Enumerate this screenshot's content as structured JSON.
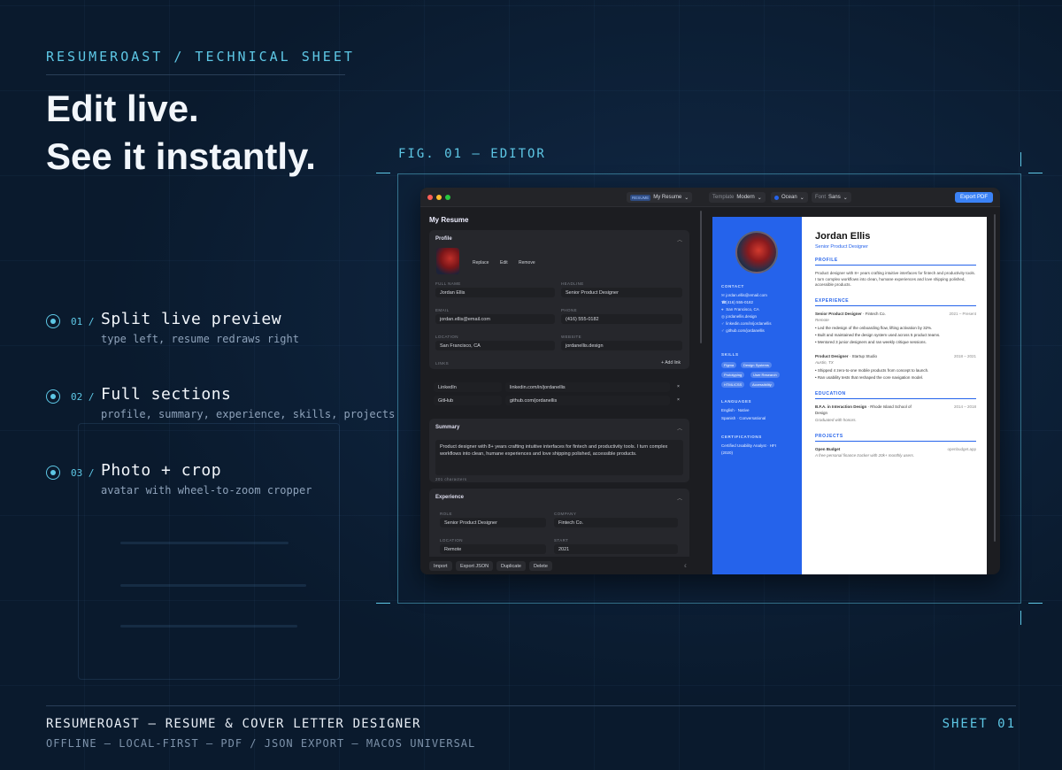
{
  "header": {
    "kicker": "RESUMEROAST / TECHNICAL SHEET",
    "headline_line1": "Edit live.",
    "headline_line2": "See it instantly."
  },
  "features": [
    {
      "num": "01 /",
      "title": "Split live preview",
      "subtitle": "type left, resume redraws right"
    },
    {
      "num": "02 /",
      "title": "Full sections",
      "subtitle": "profile, summary, experience, skills, projects"
    },
    {
      "num": "03 /",
      "title": "Photo + crop",
      "subtitle": "avatar with wheel-to-zoom cropper"
    }
  ],
  "figure": {
    "label": "FIG. 01 — EDITOR"
  },
  "app": {
    "toolbar": {
      "doc_badge": "RESUME",
      "doc_name": "My Resume",
      "template_label": "Template",
      "template_value": "Modern",
      "color_value": "Ocean",
      "font_label": "Font",
      "font_value": "Sans",
      "export_label": "Export PDF",
      "chevron": "⌄"
    },
    "editor": {
      "title": "My Resume",
      "profile": {
        "heading": "Profile",
        "replace": "Replace",
        "edit": "Edit",
        "remove": "Remove",
        "full_name_label": "FULL NAME",
        "full_name": "Jordan Ellis",
        "headline_label": "HEADLINE",
        "headline": "Senior Product Designer",
        "email_label": "EMAIL",
        "email": "jordan.ellis@email.com",
        "phone_label": "PHONE",
        "phone": "(416) 555-0182",
        "location_label": "LOCATION",
        "location": "San Francisco, CA",
        "website_label": "WEBSITE",
        "website": "jordanellis.design",
        "links_label": "LINKS",
        "add_link": "+ Add link",
        "links": [
          {
            "name": "LinkedIn",
            "url": "linkedin.com/in/jordanellis"
          },
          {
            "name": "GitHub",
            "url": "github.com/jordanellis"
          }
        ],
        "remove_x": "×"
      },
      "summary": {
        "heading": "Summary",
        "text": "Product designer with 8+ years crafting intuitive interfaces for fintech and productivity tools. I turn complex workflows into clean, humane experiences and love shipping polished, accessible products.",
        "count": "201 characters"
      },
      "experience": {
        "heading": "Experience",
        "role_label": "ROLE",
        "role": "Senior Product Designer",
        "company_label": "COMPANY",
        "company": "Fintech Co.",
        "location_label": "LOCATION",
        "location": "Remote",
        "start_label": "START",
        "start": "2021"
      },
      "footer": {
        "import": "Import",
        "export_json": "Export JSON",
        "duplicate": "Duplicate",
        "delete": "Delete",
        "theme_icon": "☾"
      }
    },
    "preview": {
      "name": "Jordan Ellis",
      "role": "Senior Product Designer",
      "contact_heading": "CONTACT",
      "contact": [
        {
          "icon": "✉",
          "text": "jordan.ellis@email.com"
        },
        {
          "icon": "☎",
          "text": "(416) 555-0182"
        },
        {
          "icon": "⌖",
          "text": "San Francisco, CA"
        },
        {
          "icon": "◎",
          "text": "jordanellis.design"
        },
        {
          "icon": "♂",
          "text": "linkedin.com/in/jordanellis"
        },
        {
          "icon": "♂",
          "text": "github.com/jordanellis"
        }
      ],
      "skills_heading": "SKILLS",
      "skills": [
        "Figma",
        "Design Systems",
        "Prototyping",
        "User Research",
        "HTML/CSS",
        "Accessibility"
      ],
      "languages_heading": "LANGUAGES",
      "languages": [
        "English · Native",
        "Spanish · Conversational"
      ],
      "certs_heading": "CERTIFICATIONS",
      "certs": [
        "Certified Usability Analyst · HFI",
        "(2020)"
      ],
      "profile_heading": "PROFILE",
      "profile_text": "Product designer with 8+ years crafting intuitive interfaces for fintech and productivity tools. I turn complex workflows into clean, humane experiences and love shipping polished, accessible products.",
      "experience_heading": "EXPERIENCE",
      "jobs": [
        {
          "title": "Senior Product Designer",
          "company": " · Fintech Co.",
          "dates": "2021 – Present",
          "place": "Remote",
          "bullets": [
            "Led the redesign of the onboarding flow, lifting activation by 32%.",
            "Built and maintained the design system used across 5 product teams.",
            "Mentored 3 junior designers and ran weekly critique sessions."
          ]
        },
        {
          "title": "Product Designer",
          "company": " · Startup Studio",
          "dates": "2018 – 2021",
          "place": "Austin, TX",
          "bullets": [
            "Shipped 4 zero-to-one mobile products from concept to launch.",
            "Ran usability tests that reshaped the core navigation model."
          ]
        }
      ],
      "education_heading": "EDUCATION",
      "education": {
        "degree": "B.F.A. in Interaction Design",
        "school": " · Rhode Island School of",
        "school2": "Design",
        "dates": "2014 – 2018",
        "note": "Graduated with honors."
      },
      "projects_heading": "PROJECTS",
      "project": {
        "name": "Open Budget",
        "url": "openbudget.app",
        "desc": "A free personal finance tracker with 20k+ monthly users."
      }
    }
  },
  "footer": {
    "title": "RESUMEROAST — RESUME & COVER LETTER DESIGNER",
    "sub": "OFFLINE — LOCAL-FIRST — PDF / JSON EXPORT — MACOS UNIVERSAL",
    "sheet": "SHEET 01"
  },
  "colors": {
    "accent": "#5ec8e6",
    "background": "#0a1a2d",
    "resume_blue": "#2563eb",
    "export_blue": "#3b82f6"
  }
}
